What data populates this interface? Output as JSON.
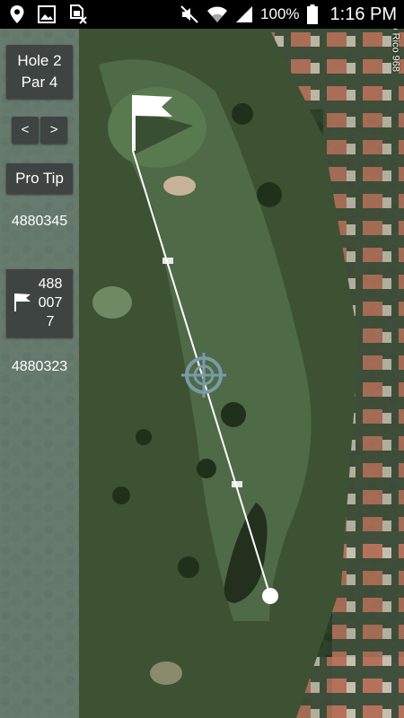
{
  "status_bar": {
    "battery": "100%",
    "time": "1:16 PM",
    "icons_left": [
      "location-icon",
      "image-icon",
      "sim-error-icon"
    ],
    "icons_right": [
      "mute-icon",
      "wifi-icon",
      "signal-icon",
      "battery-icon"
    ]
  },
  "panel": {
    "hole": "Hole 2",
    "par": "Par 4",
    "prev_label": "<",
    "next_label": ">",
    "pro_tip_label": "Pro Tip",
    "distance_top": "4880345",
    "distance_pin": "4880077",
    "distance_bottom": "4880323"
  },
  "map": {
    "road_label": "erto Rico 968",
    "colors": {
      "fairway": "#4e6a46",
      "rough": "#3c5233",
      "water": "#22301d",
      "line": "#ffffff"
    }
  }
}
